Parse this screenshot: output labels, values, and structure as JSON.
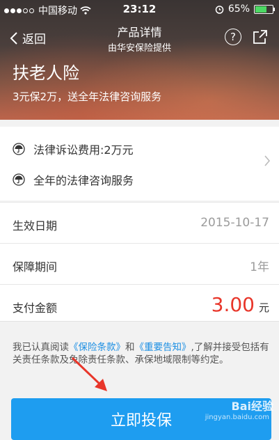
{
  "statusbar": {
    "carrier": "中国移动",
    "time": "23:12",
    "battery": "65%",
    "battery_level": 0.65
  },
  "nav": {
    "back_label": "返回",
    "title": "产品详情",
    "subtitle": "由华安保险提供",
    "help_label": "?"
  },
  "product": {
    "name": "扶老人险",
    "description": "3元保2万，送全年法律咨询服务"
  },
  "features": [
    {
      "label": "法律诉讼费用:2万元"
    },
    {
      "label": "全年的法律咨询服务"
    }
  ],
  "details": {
    "effective_date_label": "生效日期",
    "effective_date_value": "2015-10-17",
    "period_label": "保障期间",
    "period_value": "1年",
    "amount_label": "支付金额",
    "amount_value": "3.00",
    "amount_unit": "元"
  },
  "agreement": {
    "prefix": "我已认真阅读",
    "link1": "《保险条款》",
    "mid": "和",
    "link2": "《重要告知》",
    "suffix": ",了解并接受包括有关责任条款及免除责任条款、承保地域限制等约定。"
  },
  "cta": {
    "label": "立即投保"
  },
  "watermark": {
    "text": "Bai经验",
    "url": "jingyan.baidu.com"
  },
  "colors": {
    "accent": "#1e9df0",
    "price": "#e8362a",
    "link": "#1a8ee3"
  }
}
